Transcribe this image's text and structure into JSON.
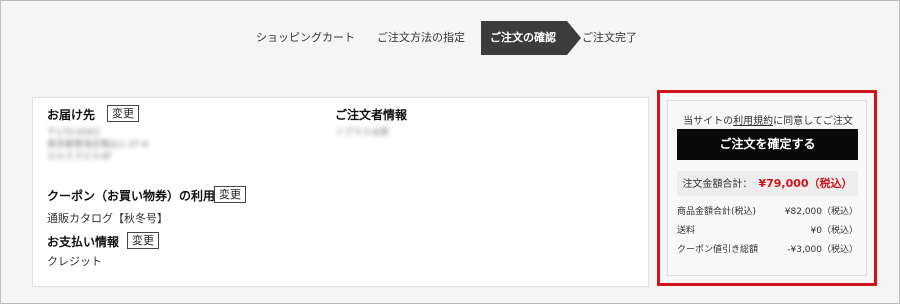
{
  "steps": [
    {
      "label": "ショッピングカート",
      "active": false
    },
    {
      "label": "ご注文方法の指定",
      "active": false
    },
    {
      "label": "ご注文の確認",
      "active": true
    },
    {
      "label": "ご注文完了",
      "active": false
    }
  ],
  "delivery": {
    "title": "お届け先",
    "edit_label": "変更",
    "address_lines": [
      "〒170-0003",
      "東京都豊島区駒込1-37-6",
      "エルミスビル4F"
    ]
  },
  "orderer": {
    "title": "ご注文者情報",
    "name": "ソプラス太郎"
  },
  "coupon": {
    "title": "クーポン（お買い物券）の利用",
    "edit_label": "変更",
    "value": "通販カタログ【秋冬号】"
  },
  "payment": {
    "title": "お支払い情報",
    "edit_label": "変更",
    "value": "クレジット"
  },
  "summary": {
    "agree_prefix": "当サイトの",
    "agree_link": "利用規約",
    "agree_suffix": "に同意してご注文",
    "confirm_label": "ご注文を確定する",
    "total_label": "注文金額合計：",
    "total_value": "¥79,000（税込）",
    "lines": [
      {
        "label": "商品金額合計(税込)",
        "value": "¥82,000（税込）"
      },
      {
        "label": "送料",
        "value": "¥0（税込）"
      },
      {
        "label": "クーポン値引き総額",
        "value": "-¥3,000（税込）"
      }
    ]
  },
  "colors": {
    "highlight": "#d0121b",
    "active_step": "#3c3c3c",
    "confirm_button": "#0a0a0a"
  }
}
